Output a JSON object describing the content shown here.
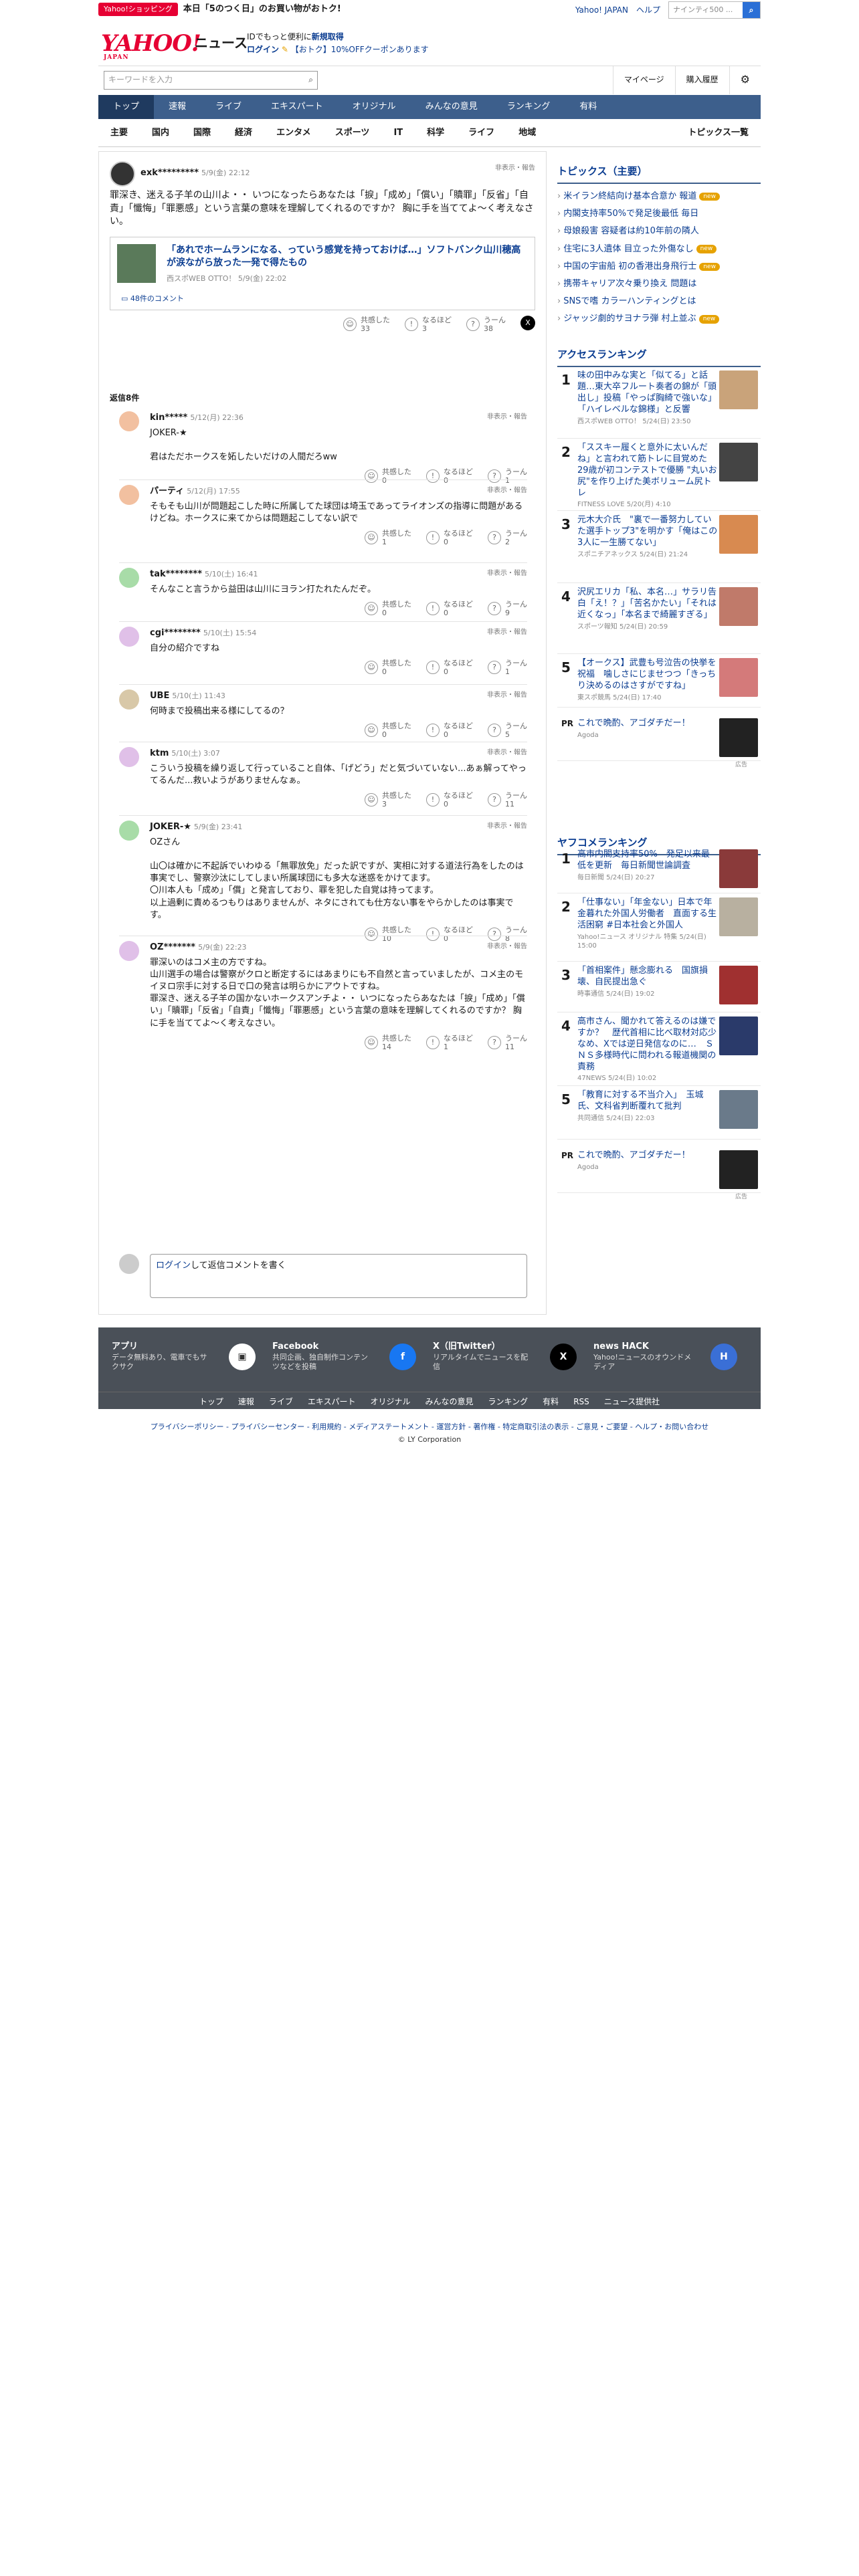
{
  "promo": {
    "tag": "Yahoo!ショッピング",
    "text": "本日「5のつく日」のお買い物がおトク!"
  },
  "toplinks": {
    "yahoo": "Yahoo! JAPAN",
    "help": "ヘルプ",
    "search_placeholder": "ウェブ検索",
    "search_value": "ナインティ500 ..."
  },
  "header": {
    "logo": "YAHOO!",
    "logo_sub": "JAPAN",
    "news": "ニュース",
    "pr1a": "IDでもっと便利に",
    "pr1b": "新規取得",
    "login": "ログイン",
    "pr2": "【おトク】10%OFFクーポンあります"
  },
  "search": {
    "placeholder": "キーワードを入力",
    "mypage": "マイページ",
    "history": "購入履歴"
  },
  "nav1": [
    "トップ",
    "速報",
    "ライブ",
    "エキスパート",
    "オリジナル",
    "みんなの意見",
    "ランキング",
    "有料"
  ],
  "nav2": [
    "主要",
    "国内",
    "国際",
    "経済",
    "エンタメ",
    "スポーツ",
    "IT",
    "科学",
    "ライフ",
    "地域"
  ],
  "nav2_last": "トピックス一覧",
  "post": {
    "user": "exk*********",
    "date": "5/9(金) 22:12",
    "report": "非表示・報告",
    "body": "罪深き、迷える子羊の山川よ・・ いつになったらあなたは「捩」「成め」「償い」「贖罪」「反省」「自責」「懺悔」「罪悪感」という言葉の意味を理解してくれるのですか？ 胸に手を当ててよ〜く考えなさい。",
    "article_title": "「あれでホームランになる、っていう感覚を持っておけば…」ソフトバンク山川穂高が涙ながら放った一発で得たもの",
    "article_src": "西スポWEB OTTO！ 5/9(金) 22:02",
    "comments_link": "48件のコメント",
    "r1": "共感した",
    "r1n": "33",
    "r2": "なるほど",
    "r2n": "3",
    "r3": "うーん",
    "r3n": "38"
  },
  "replies_label": "返信8件",
  "labels": {
    "empathy": "共感した",
    "naruhodo": "なるほど",
    "uun": "うーん",
    "report": "非表示・報告"
  },
  "comments": [
    {
      "user": "kin*****",
      "date": "5/12(月) 22:36",
      "body": "JOKER-★\n\n君はただホークスを妬したいだけの人間だろww",
      "a": "0",
      "b": "0",
      "c": "1"
    },
    {
      "user": "パーティ",
      "date": "5/12(月) 17:55",
      "body": "そもそも山川が問題起こした時に所属してた球団は埼玉であってライオンズの指導に問題があるけどね。ホークスに来てからは問題起こしてない訳で",
      "a": "1",
      "b": "0",
      "c": "2"
    },
    {
      "user": "tak********",
      "date": "5/10(土) 16:41",
      "body": "そんなこと言うから益田は山川にヨラン打たれたんだぞ。",
      "a": "0",
      "b": "0",
      "c": "9"
    },
    {
      "user": "cgi********",
      "date": "5/10(土) 15:54",
      "body": "自分の紹介ですね",
      "a": "0",
      "b": "0",
      "c": "1"
    },
    {
      "user": "UBE",
      "date": "5/10(土) 11:43",
      "body": "何時まで投稿出来る様にしてるの？",
      "a": "0",
      "b": "0",
      "c": "5"
    },
    {
      "user": "ktm",
      "date": "5/10(土) 3:07",
      "body": "こういう投稿を繰り返して行っていること自体、「げどう」だと気づいていない...あぁ解ってやってるんだ...救いようがありませんなぁ。",
      "a": "3",
      "b": "0",
      "c": "11"
    },
    {
      "user": "JOKER-★",
      "date": "5/9(金) 23:41",
      "body": "OZさん\n\n山〇は確かに不起訴でいわゆる「無罪放免」だった訳ですが、実相に対する道法行為をしたのは事実でし、警察沙汰にしてしまい所属球団にも多大な迷惑をかけてます。\n〇川本人も「成め」「償」と発言しており、罪を犯した自覚は持ってます。\n以上過剰に責めるつもりはありませんが、ネタにされても仕方ない事をやらかしたのは事実です。",
      "a": "10",
      "b": "0",
      "c": "8"
    },
    {
      "user": "OZ*******",
      "date": "5/9(金) 22:23",
      "body": "罪深いのはコメ主の方ですね。\n山川選手の場合は警察がクロと断定するにはあまりにも不自然と言っていましたが、コメ主のモイヌロ宗手に対する日で口の発言は明らかにアウトですね。\n罪深き、迷える子羊の国かないホークスアンチよ・・ いつになったらあなたは「捩」「成め」「償い」「贖罪」「反省」「自責」「懺悔」「罪悪感」という言葉の意味を理解してくれるのですか？ 胸に手を当ててよ〜く考えなさい。",
      "a": "14",
      "b": "1",
      "c": "11"
    }
  ],
  "reply_box": {
    "login": "ログイン",
    "text": "して返信コメントを書く"
  },
  "topics": {
    "title": "トピックス（主要）",
    "items": [
      {
        "t": "米イラン終結向け基本合意か 報道",
        "badge": "new"
      },
      {
        "t": "内閣支持率50%で発足後最低 毎日",
        "badge": ""
      },
      {
        "t": "母娘殺害 容疑者は約10年前の隣人",
        "badge": ""
      },
      {
        "t": "住宅に3人遺体 目立った外傷なし",
        "badge": "new"
      },
      {
        "t": "中国の宇宙船 初の香港出身飛行士",
        "badge": "new"
      },
      {
        "t": "携帯キャリア次々乗り換え 問題は",
        "badge": ""
      },
      {
        "t": "SNSで嗜 カラーハンティングとは",
        "badge": ""
      },
      {
        "t": "ジャッジ劇的サヨナラ弾 村上並ぶ",
        "badge": "new"
      }
    ]
  },
  "access_ranking": {
    "title": "アクセスランキング",
    "items": [
      {
        "n": "1",
        "t": "味の田中みな実と「似てる」と話題…東大卒フルート奏者の錦が「頭出し」投稿「やっぱ胸綺で強いな」「ハイレベルな錦様」と反響",
        "s": "西スポWEB OTTO！ 5/24(日) 23:50"
      },
      {
        "n": "2",
        "t": "「ススキー履くと意外に太いんだね」と言われて筋トレに目覚めた29歳が初コンテストで優勝 \"丸いお尻\"を作り上げた美ボリューム尻トレ",
        "s": "FITNESS LOVE 5/20(月) 4:10"
      },
      {
        "n": "3",
        "t": "元木大介氏　\"裏で一番努力していた選手トップ3\"を明かす「俺はこの3人に一生勝てない」",
        "s": "スポニチアネックス 5/24(日) 21:24"
      },
      {
        "n": "4",
        "t": "沢尻エリカ「私、本名…」サラリ告白「え！？」「苦名かたい」「それは近くなっ」「本名まで綺麗すぎる」",
        "s": "スポーツ報知 5/24(日) 20:59"
      },
      {
        "n": "5",
        "t": "【オークス】武豊も号泣告の快挙を祝福　噛しさにじませつつ「きっちり決めるのはさすがですね」",
        "s": "東スポ競馬 5/24(日) 17:40"
      }
    ],
    "pr_t": "これで晩酌、アゴダチだー！",
    "pr_s": "Agoda",
    "ad": "広告"
  },
  "yafoo_ranking": {
    "title": "ヤフコメランキング",
    "items": [
      {
        "n": "1",
        "t": "高市内閣支持率50%　発足以来最低を更新　毎日新聞世論調査",
        "s": "毎日新聞 5/24(日) 20:27"
      },
      {
        "n": "2",
        "t": "「仕事ない」「年金ない」日本で年金暮れた外国人労働者　直面する生活困窮 #日本社会と外国人",
        "s": "Yahoo!ニュース オリジナル 特集 5/24(日) 15:00"
      },
      {
        "n": "3",
        "t": "「首相案件」懸念膨れる　国旗損壊、自民提出急ぐ",
        "s": "時事通信 5/24(日) 19:02"
      },
      {
        "n": "4",
        "t": "高市さん、聞かれて答えるのは嫌ですか？　歴代首相に比べ取材対応少なめ、Xでは逆日発信なのに…　ＳＮＳ多様時代に問われる報道機関の責務",
        "s": "47NEWS 5/24(日) 10:02"
      },
      {
        "n": "5",
        "t": "「教育に対する不当介入」　玉城氏、文科省判断覆れて批判",
        "s": "共同通信 5/24(日) 22:03"
      }
    ],
    "pr_t": "これで晩酌、アゴダチだー！",
    "pr_s": "Agoda",
    "ad": "広告"
  },
  "footer": {
    "apps": [
      {
        "t": "アプリ",
        "d": "データ無料あり、電車でもサクサク"
      },
      {
        "t": "Facebook",
        "d": "共同企画、独自制作コンテンツなどを投稿"
      },
      {
        "t": "X（旧Twitter）",
        "d": "リアルタイムでニュースを配信"
      },
      {
        "t": "news HACK",
        "d": "Yahoo!ニュースのオウンドメディア"
      }
    ],
    "nav": [
      "トップ",
      "速報",
      "ライブ",
      "エキスパート",
      "オリジナル",
      "みんなの意見",
      "ランキング",
      "有料",
      "RSS",
      "ニュース提供社"
    ],
    "legal": "プライバシーポリシー - プライバシーセンター - 利用規約 - メディアステートメント - 運営方針 - 著作権 - 特定商取引法の表示 - ご意見・ご要望 - ヘルプ・お問い合わせ",
    "copy": "© LY Corporation"
  }
}
